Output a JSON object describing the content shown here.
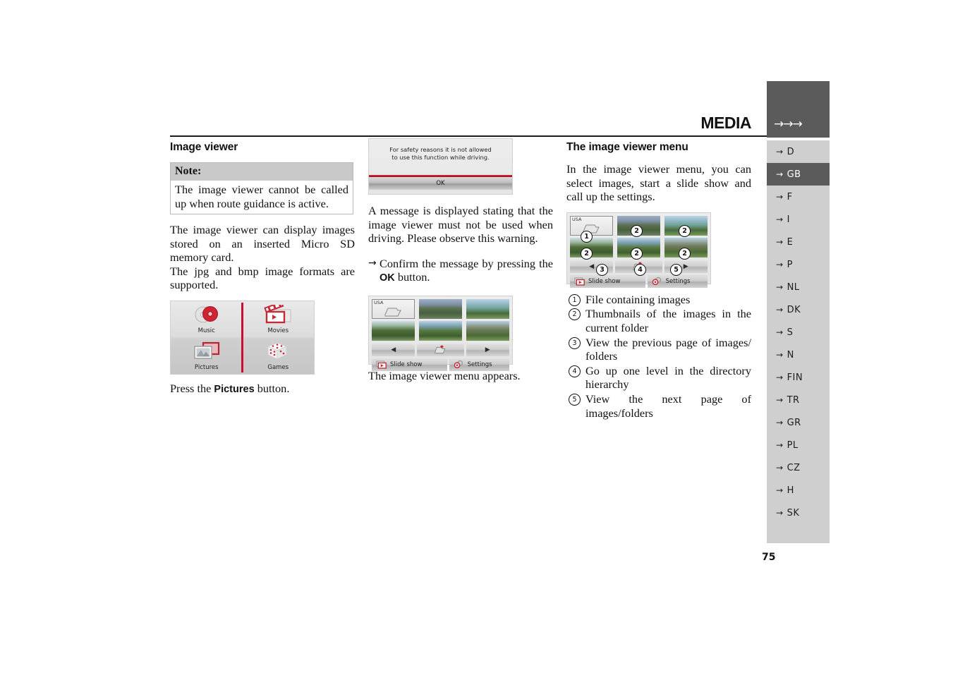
{
  "header": {
    "title": "MEDIA",
    "arrows": "→→→"
  },
  "sidebar": {
    "items": [
      {
        "label": "D",
        "active": false
      },
      {
        "label": "GB",
        "active": true
      },
      {
        "label": "F",
        "active": false
      },
      {
        "label": "I",
        "active": false
      },
      {
        "label": "E",
        "active": false
      },
      {
        "label": "P",
        "active": false
      },
      {
        "label": "NL",
        "active": false
      },
      {
        "label": "DK",
        "active": false
      },
      {
        "label": "S",
        "active": false
      },
      {
        "label": "N",
        "active": false
      },
      {
        "label": "FIN",
        "active": false
      },
      {
        "label": "TR",
        "active": false
      },
      {
        "label": "GR",
        "active": false
      },
      {
        "label": "PL",
        "active": false
      },
      {
        "label": "CZ",
        "active": false
      },
      {
        "label": "H",
        "active": false
      },
      {
        "label": "SK",
        "active": false
      }
    ],
    "arrow_glyph": "→"
  },
  "page_number": "75",
  "column1": {
    "heading": "Image viewer",
    "note": {
      "title": "Note:",
      "body": "The image viewer cannot be called up when route guidance is active."
    },
    "para1": "The  image viewer can display images stored on an inserted Micro SD memory card.",
    "para2": "The jpg and bmp image formats are supported.",
    "media_menu": {
      "tiles": [
        {
          "label": "Music",
          "icon": "cd-discs-icon"
        },
        {
          "label": "Movies",
          "icon": "film-clapper-icon"
        },
        {
          "label": "Pictures",
          "icon": "photo-frames-icon"
        },
        {
          "label": "Games",
          "icon": "dice-icon"
        }
      ]
    },
    "press_prefix": "Press the ",
    "press_bold": "Pictures",
    "press_suffix": " button."
  },
  "column2": {
    "warning_dialog": {
      "line1": "For safety reasons it is not allowed",
      "line2": "to use this function while driving.",
      "ok_label": "OK"
    },
    "para1": "A message is displayed stating that the image viewer must not be used when driving. Please observe this warning.",
    "instruction": {
      "arrow": "→",
      "text_before": "Confirm  the  message  by  pressing  the ",
      "bold": "OK",
      "text_after": " button."
    },
    "viewer_screenshot": {
      "folder_label": "USA",
      "prev_label": "◀",
      "up_label": "",
      "next_label": "▶",
      "slideshow_label": "Slide show",
      "settings_label": "Settings"
    },
    "caption": "The image viewer menu appears."
  },
  "column3": {
    "heading": "The image viewer menu",
    "para1": "In the image viewer menu, you can select images, start a slide show and call up the settings.",
    "annotated_screenshot": {
      "folder_label": "USA",
      "slideshow_label": "Slide show",
      "settings_label": "Settings",
      "badges": [
        "1",
        "2",
        "2",
        "2",
        "2",
        "2",
        "3",
        "4",
        "5"
      ]
    },
    "legend": [
      {
        "num": "1",
        "text": "File containing images"
      },
      {
        "num": "2",
        "text": "Thumbnails of the images in the current folder"
      },
      {
        "num": "3",
        "text": "View  the  previous  page  of  images/ folders"
      },
      {
        "num": "4",
        "text": "Go up one level in the directory hierarchy"
      },
      {
        "num": "5",
        "text": "View the next page of images/folders"
      }
    ]
  },
  "colors": {
    "accent_red": "#c8102e",
    "sidebar_dark": "#5b5b5b",
    "sidebar_light": "#cfcfcf"
  }
}
